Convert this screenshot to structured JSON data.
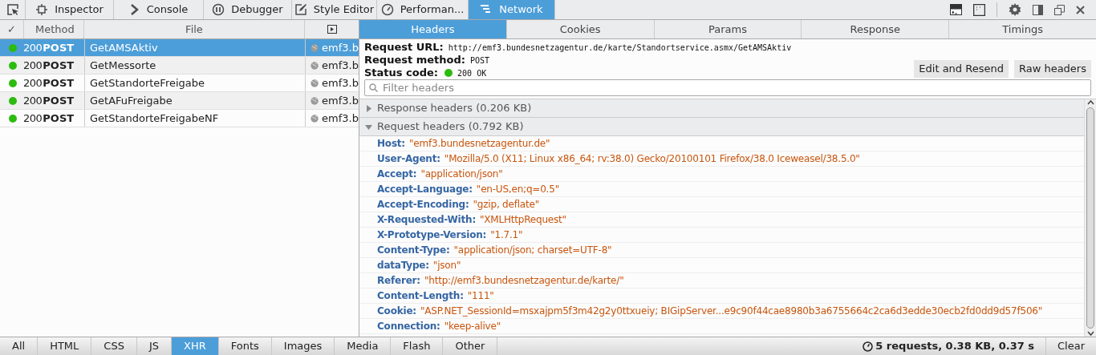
{
  "toolbar": {
    "tabs": [
      {
        "label": "Inspector",
        "selected": false
      },
      {
        "label": "Console",
        "selected": false
      },
      {
        "label": "Debugger",
        "selected": false
      },
      {
        "label": "Style Editor",
        "selected": false
      },
      {
        "label": "Performan...",
        "selected": false
      },
      {
        "label": "Network",
        "selected": true
      }
    ]
  },
  "requests": {
    "columns": [
      "✓",
      "Method",
      "File"
    ],
    "rows": [
      {
        "status": "200",
        "method": "POST",
        "file": "GetAMSAktiv",
        "domain": "emf3.b",
        "selected": true
      },
      {
        "status": "200",
        "method": "POST",
        "file": "GetMessorte",
        "domain": "emf3.b",
        "selected": false
      },
      {
        "status": "200",
        "method": "POST",
        "file": "GetStandorteFreigabe",
        "domain": "emf3.b",
        "selected": false
      },
      {
        "status": "200",
        "method": "POST",
        "file": "GetAFuFreigabe",
        "domain": "emf3.b",
        "selected": false
      },
      {
        "status": "200",
        "method": "POST",
        "file": "GetStandorteFreigabeNF",
        "domain": "emf3.b",
        "selected": false
      }
    ]
  },
  "details": {
    "tabs": [
      {
        "label": "Headers",
        "selected": true
      },
      {
        "label": "Cookies",
        "selected": false
      },
      {
        "label": "Params",
        "selected": false
      },
      {
        "label": "Response",
        "selected": false
      },
      {
        "label": "Timings",
        "selected": false
      }
    ],
    "summary": [
      {
        "label": "Request URL:",
        "value": "http://emf3.bundesnetzagentur.de/karte/Standortservice.asmx/GetAMSAktiv"
      },
      {
        "label": "Request method:",
        "value": "POST"
      },
      {
        "label": "Status code:",
        "value": "200 OK"
      }
    ],
    "buttons": [
      "Edit and Resend",
      "Raw headers"
    ],
    "filter": {
      "placeholder": "Filter headers"
    },
    "sections": [
      {
        "title": "Response headers (0.206 KB)",
        "expanded": false
      },
      {
        "title": "Request headers (0.792 KB)",
        "expanded": true
      }
    ],
    "headers": [
      {
        "name": "Host:",
        "value": "\"emf3.bundesnetzagentur.de\""
      },
      {
        "name": "User-Agent:",
        "value": "\"Mozilla/5.0 (X11; Linux x86_64; rv:38.0) Gecko/20100101 Firefox/38.0 Iceweasel/38.5.0\""
      },
      {
        "name": "Accept:",
        "value": "\"application/json\""
      },
      {
        "name": "Accept-Language:",
        "value": "\"en-US,en;q=0.5\""
      },
      {
        "name": "Accept-Encoding:",
        "value": "\"gzip, deflate\""
      },
      {
        "name": "X-Requested-With:",
        "value": "\"XMLHttpRequest\""
      },
      {
        "name": "X-Prototype-Version:",
        "value": "\"1.7.1\""
      },
      {
        "name": "Content-Type:",
        "value": "\"application/json; charset=UTF-8\""
      },
      {
        "name": "dataType:",
        "value": "\"json\""
      },
      {
        "name": "Referer:",
        "value": "\"http://emf3.bundesnetzagentur.de/karte/\""
      },
      {
        "name": "Content-Length:",
        "value": "\"111\""
      },
      {
        "name": "Cookie:",
        "value": "\"ASP.NET_SessionId=msxajpm5f3m42g2y0ttxueiy; BIGipServer...e9c90f44cae8980b3a6755664c2ca6d3edde30ecb2fd0dd9d57f506\""
      },
      {
        "name": "Connection:",
        "value": "\"keep-alive\""
      }
    ]
  },
  "footer": {
    "filters": [
      {
        "label": "All",
        "selected": false
      },
      {
        "label": "HTML",
        "selected": false
      },
      {
        "label": "CSS",
        "selected": false
      },
      {
        "label": "JS",
        "selected": false
      },
      {
        "label": "XHR",
        "selected": true
      },
      {
        "label": "Fonts",
        "selected": false
      },
      {
        "label": "Images",
        "selected": false
      },
      {
        "label": "Media",
        "selected": false
      },
      {
        "label": "Flash",
        "selected": false
      },
      {
        "label": "Other",
        "selected": false
      }
    ],
    "summary": "5 requests, 0.38 KB, 0.37 s",
    "clear": "Clear"
  }
}
